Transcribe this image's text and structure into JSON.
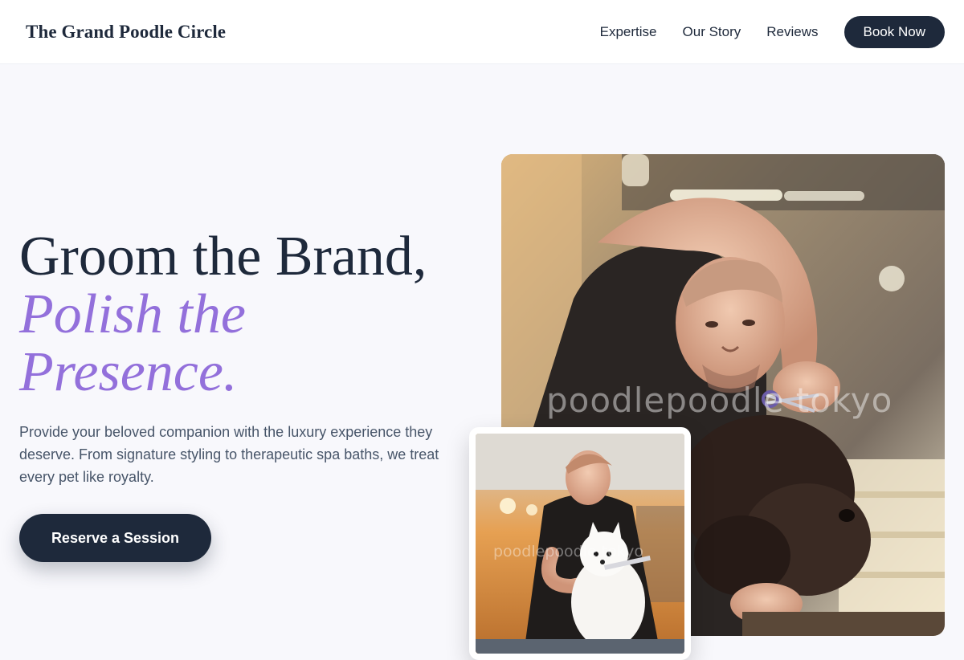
{
  "header": {
    "brand": "The Grand Poodle Circle",
    "nav": [
      "Expertise",
      "Our Story",
      "Reviews"
    ],
    "book_label": "Book Now"
  },
  "hero": {
    "headline_line1": "Groom the Brand,",
    "headline_accent_line1": "Polish the",
    "headline_accent_line2": "Presence.",
    "description": "Provide your beloved companion with the luxury experience they deserve. From signature styling to therapeutic spa baths, we treat every pet like royalty.",
    "cta_label": "Reserve a Session"
  },
  "images": {
    "main_watermark": "poodlepoodle tokyo",
    "inset_watermark": "poodlepoodle tokyo"
  },
  "colors": {
    "primary": "#1e293b",
    "accent": "#9370db",
    "background": "#f8f8fc"
  }
}
